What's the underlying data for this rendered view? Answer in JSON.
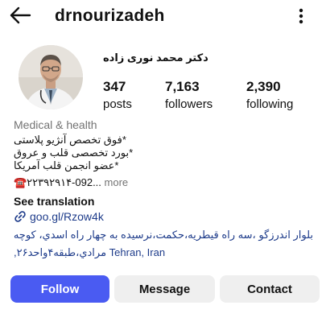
{
  "header": {
    "username": "drnourizadeh"
  },
  "profile": {
    "full_name": "دکتر محمد نوری زاده",
    "stats": [
      {
        "value": "347",
        "label": "posts"
      },
      {
        "value": "7,163",
        "label": "followers"
      },
      {
        "value": "2,390",
        "label": "following"
      }
    ],
    "category": "Medical & health",
    "bio_lines": [
      "*فوق تخصص آنژیو پلاستی",
      "*بورد تخصصی قلب و عروق",
      "*عضو انجمن قلب آمریکا"
    ],
    "phone_text": "☎️۲۲۳۹۲۹۱۴-092...",
    "more_label": " more",
    "see_translation": "See translation",
    "link": "goo.gl/Rzow4k",
    "address_line1": "بلوار اندرزگو ،سه راه قيطريه،حكمت،نرسيده به چهار راه اسدي، كوچه",
    "address_line2_rtl": "مرادي،طبقه۴واحد۲۶,",
    "address_line2_ltr": " Tehran, Iran"
  },
  "actions": {
    "follow": "Follow",
    "message": "Message",
    "contact": "Contact"
  }
}
